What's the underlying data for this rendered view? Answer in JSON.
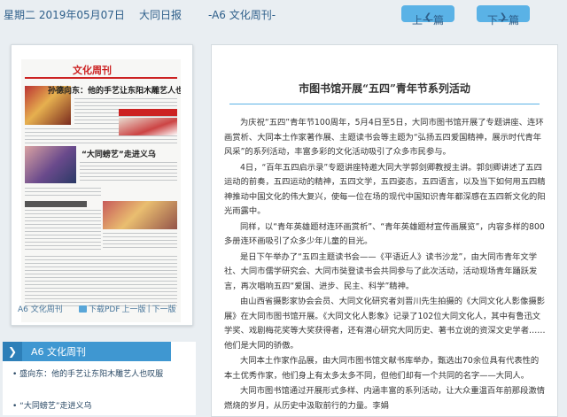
{
  "header": {
    "date": "星期二 2019年05月07日",
    "paper": "大同日报",
    "edition": "-A6 文化周刊-",
    "prev_label": "上一篇",
    "next_label": "下一篇"
  },
  "page_preview": {
    "masthead": "文化周刊",
    "headline_1": "孙德向东：他的手艺让东阳木雕艺人也叹服",
    "headline_2": "“大同螃艺”走进义乌",
    "edition_label": "A6 文化周刊",
    "pdf_label": "下载PDF",
    "prev_edition": "上一版",
    "next_edition": "下一版"
  },
  "section": {
    "title": "A6  文化周刊",
    "items": [
      "盛向东：他的手艺让东阳木雕艺人也叹服",
      "“大同螃艺”走进义乌"
    ]
  },
  "article": {
    "title": "市图书馆开展“五四”青年节系列活动",
    "paragraphs": [
      "为庆祝“五四”青年节100周年，5月4日至5日，大同市图书馆开展了专题讲座、连环画赏析、大同本土作家著作展、主题读书会等主题为“弘扬五四爱国精神，展示时代青年风采”的系列活动，丰富多彩的文化活动吸引了众多市民参与。",
      "4日，“百年五四启示录”专题讲座特邀大同大学郭剑卿教授主讲。郭剑卿讲述了五四运动的前奏，五四运动的精神，五四文学，五四姿态，五四语言，以及当下如何用五四精神推动中国文化的伟大复兴，使每一位在场的现代中国知识青年都深感在五四新文化的阳光雨露中。",
      "同样，以“青年英雄题材连环画赏析”、“青年英雄题材宣传画展览”，内容多样的800多册连环画吸引了众多少年儿童的目光。",
      "是日下午举办了“五四主题读书会——《平语近人》读书沙龙”，由大同市青年文学社、大同市儒学研究会、大同市奘登读书会共同参与了此次活动，活动现场青年踊跃发言，再次唱响五四“爱国、进步、民主、科学”精神。",
      "由山西省摄影家协会会员、大同文化研究者刘晋川先生拍摄的《大同文化人影像摄影展》在大同市图书馆开展。《大同文化人影象》记录了102位大同文化人，其中有鲁迅文学奖、戏剧梅花奖等大奖获得者，还有潜心研究大同历史、著书立说的资深文史学者……他们是大同的骄傲。",
      "大同本土作家作品展，由大同市图书馆文献书库举办，甄选出70余位具有代表性的本土优秀作家，他们身上有太多太多不同，但他们却有一个共同的名字——大同人。",
      "大同市图书馆通过开展形式多样、内涵丰富的系列活动，让大众重温百年前那段激情燃烧的岁月，从历史中汲取前行的力量。李娟"
    ]
  }
}
